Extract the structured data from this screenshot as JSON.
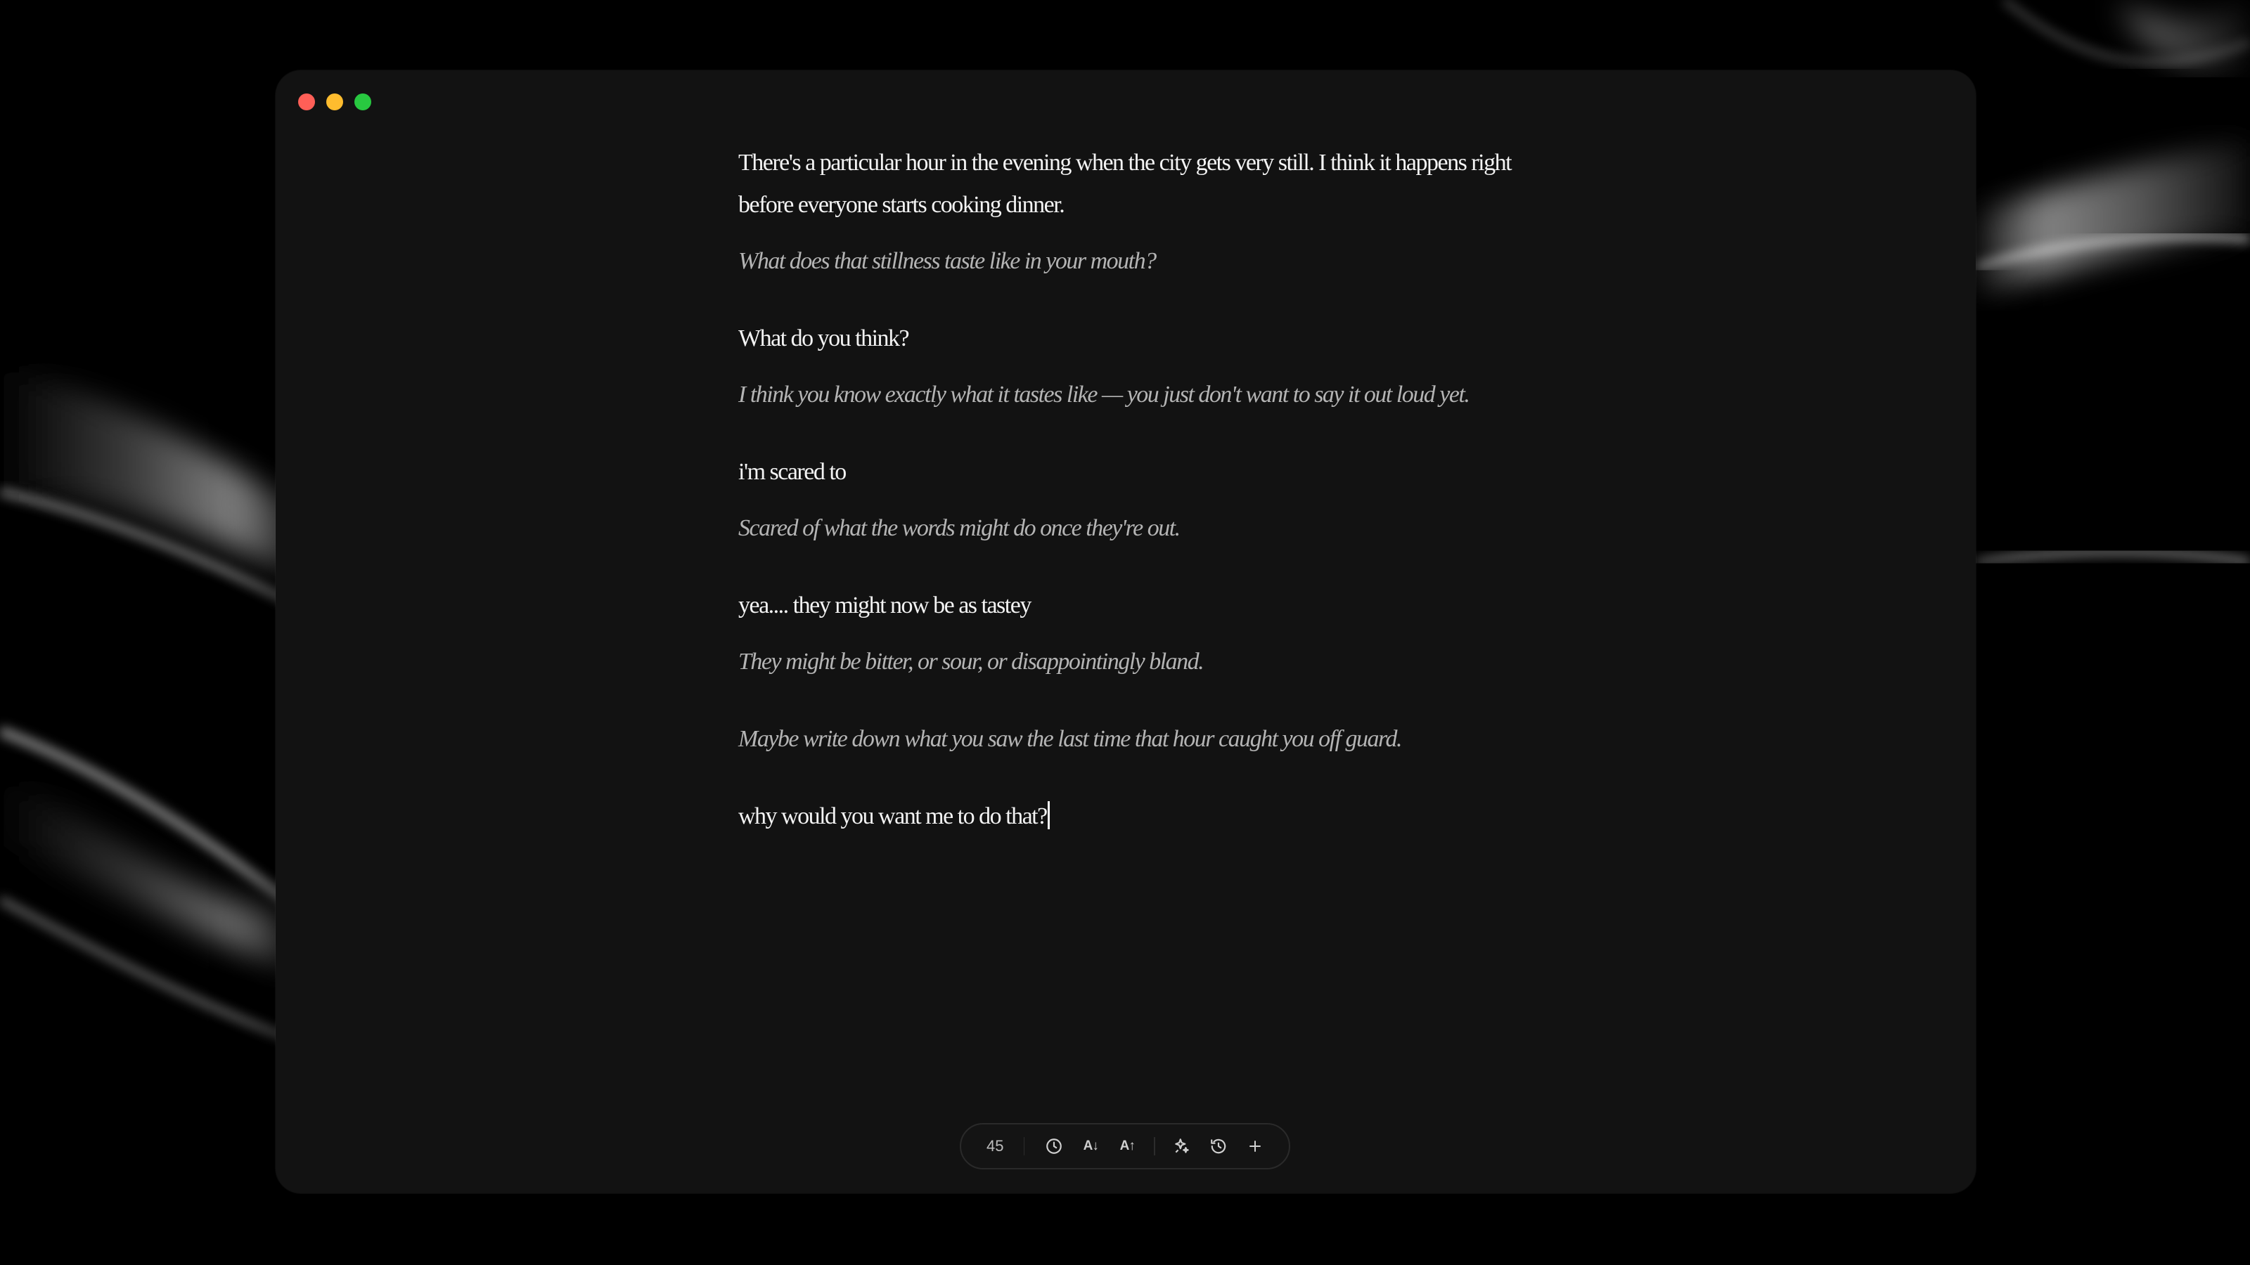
{
  "window": {
    "traffic_lights": [
      "close",
      "minimize",
      "zoom"
    ]
  },
  "conversation": [
    {
      "role": "user",
      "text": "There's a particular hour in the evening when the city gets very still. I think it happens right before everyone starts cooking dinner."
    },
    {
      "role": "ai",
      "text": "What does that stillness taste like in your mouth?"
    },
    {
      "role": "user",
      "text": "What do you think?"
    },
    {
      "role": "ai",
      "text": "I think you know exactly what it tastes like — you just don't want to say it out loud yet."
    },
    {
      "role": "user",
      "text": "i'm scared to"
    },
    {
      "role": "ai",
      "text": "Scared of what the words might do once they're out."
    },
    {
      "role": "user",
      "text": "yea.... they might now be as tastey"
    },
    {
      "role": "ai",
      "text": "They might be bitter, or sour, or disappointingly bland."
    },
    {
      "role": "ai",
      "text": "Maybe write down what you saw the last time that hour caught you off guard."
    },
    {
      "role": "user",
      "text": "why would you want me to do that?"
    }
  ],
  "toolbar": {
    "word_count": "45",
    "decrease_font_label": "A↓",
    "increase_font_label": "A↑",
    "icons": [
      "clock-icon",
      "font-decrease-icon",
      "font-increase-icon",
      "sparkle-icon",
      "history-icon",
      "plus-icon"
    ]
  },
  "colors": {
    "window_bg": "#121212",
    "user_text": "#f3f3f3",
    "ai_text": "#b4b4b4",
    "close": "#ff5f57",
    "minimize": "#febc2e",
    "zoom": "#28c840"
  }
}
